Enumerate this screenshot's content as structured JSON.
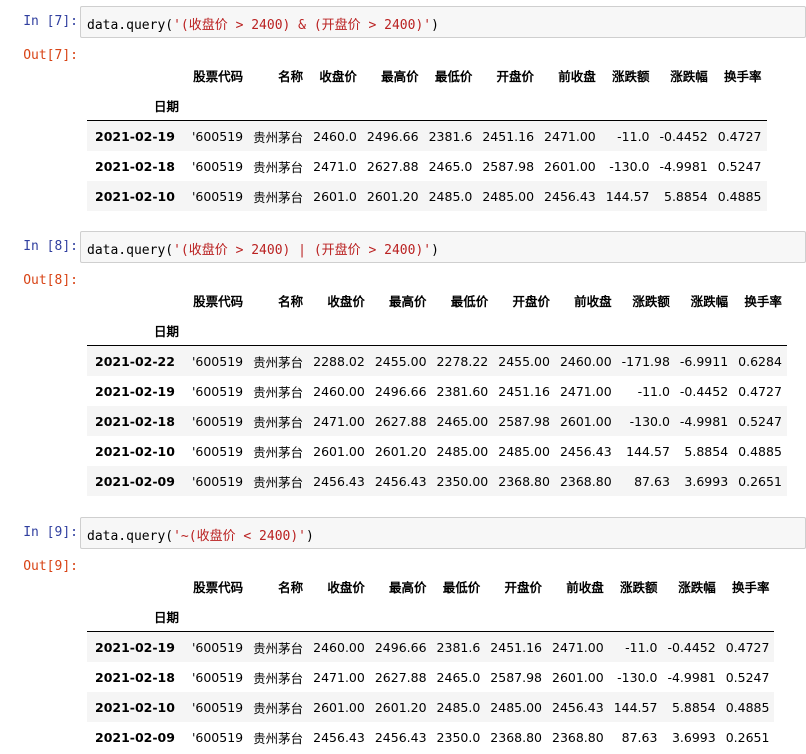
{
  "columns": [
    "股票代码",
    "名称",
    "收盘价",
    "最高价",
    "最低价",
    "开盘价",
    "前收盘",
    "涨跌额",
    "涨跌幅",
    "换手率"
  ],
  "index_name": "日期",
  "cells": [
    {
      "in_prompt": "In  [7]:",
      "out_prompt": "Out[7]:",
      "code_prefix": "data.query(",
      "code_string": "'(收盘价 > 2400) & (开盘价 > 2400)'",
      "code_suffix": ")",
      "rows": [
        {
          "index": "2021-02-19",
          "values": [
            "'600519",
            "贵州茅台",
            "2460.0",
            "2496.66",
            "2381.6",
            "2451.16",
            "2471.00",
            "-11.0",
            "-0.4452",
            "0.4727"
          ]
        },
        {
          "index": "2021-02-18",
          "values": [
            "'600519",
            "贵州茅台",
            "2471.0",
            "2627.88",
            "2465.0",
            "2587.98",
            "2601.00",
            "-130.0",
            "-4.9981",
            "0.5247"
          ]
        },
        {
          "index": "2021-02-10",
          "values": [
            "'600519",
            "贵州茅台",
            "2601.0",
            "2601.20",
            "2485.0",
            "2485.00",
            "2456.43",
            "144.57",
            "5.8854",
            "0.4885"
          ]
        }
      ]
    },
    {
      "in_prompt": "In  [8]:",
      "out_prompt": "Out[8]:",
      "code_prefix": "data.query(",
      "code_string": "'(收盘价 > 2400) | (开盘价 > 2400)'",
      "code_suffix": ")",
      "rows": [
        {
          "index": "2021-02-22",
          "values": [
            "'600519",
            "贵州茅台",
            "2288.02",
            "2455.00",
            "2278.22",
            "2455.00",
            "2460.00",
            "-171.98",
            "-6.9911",
            "0.6284"
          ]
        },
        {
          "index": "2021-02-19",
          "values": [
            "'600519",
            "贵州茅台",
            "2460.00",
            "2496.66",
            "2381.60",
            "2451.16",
            "2471.00",
            "-11.0",
            "-0.4452",
            "0.4727"
          ]
        },
        {
          "index": "2021-02-18",
          "values": [
            "'600519",
            "贵州茅台",
            "2471.00",
            "2627.88",
            "2465.00",
            "2587.98",
            "2601.00",
            "-130.0",
            "-4.9981",
            "0.5247"
          ]
        },
        {
          "index": "2021-02-10",
          "values": [
            "'600519",
            "贵州茅台",
            "2601.00",
            "2601.20",
            "2485.00",
            "2485.00",
            "2456.43",
            "144.57",
            "5.8854",
            "0.4885"
          ]
        },
        {
          "index": "2021-02-09",
          "values": [
            "'600519",
            "贵州茅台",
            "2456.43",
            "2456.43",
            "2350.00",
            "2368.80",
            "2368.80",
            "87.63",
            "3.6993",
            "0.2651"
          ]
        }
      ]
    },
    {
      "in_prompt": "In  [9]:",
      "out_prompt": "Out[9]:",
      "code_prefix": "data.query(",
      "code_string": "'~(收盘价 < 2400)'",
      "code_suffix": ")",
      "rows": [
        {
          "index": "2021-02-19",
          "values": [
            "'600519",
            "贵州茅台",
            "2460.00",
            "2496.66",
            "2381.6",
            "2451.16",
            "2471.00",
            "-11.0",
            "-0.4452",
            "0.4727"
          ]
        },
        {
          "index": "2021-02-18",
          "values": [
            "'600519",
            "贵州茅台",
            "2471.00",
            "2627.88",
            "2465.0",
            "2587.98",
            "2601.00",
            "-130.0",
            "-4.9981",
            "0.5247"
          ]
        },
        {
          "index": "2021-02-10",
          "values": [
            "'600519",
            "贵州茅台",
            "2601.00",
            "2601.20",
            "2485.0",
            "2485.00",
            "2456.43",
            "144.57",
            "5.8854",
            "0.4885"
          ]
        },
        {
          "index": "2021-02-09",
          "values": [
            "'600519",
            "贵州茅台",
            "2456.43",
            "2456.43",
            "2350.0",
            "2368.80",
            "2368.80",
            "87.63",
            "3.6993",
            "0.2651"
          ]
        }
      ]
    }
  ]
}
